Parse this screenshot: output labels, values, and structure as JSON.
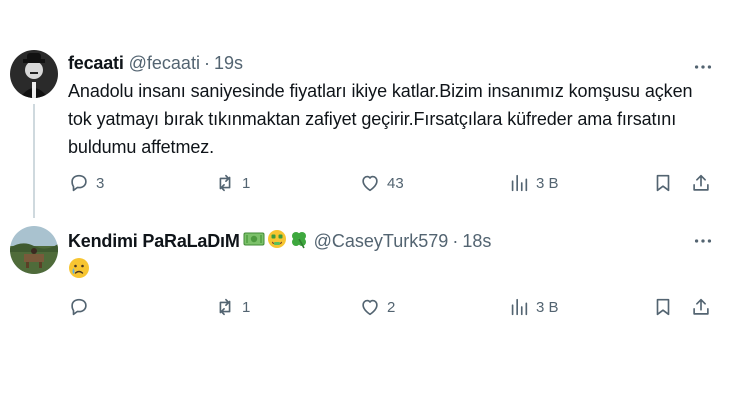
{
  "tweet1": {
    "display_name": "fecaati",
    "handle": "@fecaati",
    "separator": "·",
    "time": "19s",
    "text": "Anadolu insanı saniyesinde fiyatları ikiye katlar.Bizim insanımız komşusu açken tok yatmayı bırak tıkınmaktan zafiyet geçirir.Fırsatçılara küfreder ama fırsatını buldumu affetmez.",
    "replies": "3",
    "reposts": "1",
    "likes": "43",
    "views": "3 B"
  },
  "tweet2": {
    "display_name": "Kendimi PaRaLaDıM",
    "name_emojis": [
      "money-bill-emoji",
      "money-mouth-face-emoji",
      "four-leaf-clover-emoji"
    ],
    "handle": "@CaseyTurk579",
    "separator": "·",
    "time": "18s",
    "text_emoji": "crying-face-emoji",
    "replies": "",
    "reposts": "1",
    "likes": "2",
    "views": "3 B"
  },
  "colors": {
    "text": "#0f1419",
    "secondary": "#536471",
    "thread_line": "#cfd9de"
  },
  "icons": [
    "reply-icon",
    "repost-icon",
    "like-icon",
    "views-icon",
    "bookmark-icon",
    "share-icon",
    "more-icon"
  ]
}
